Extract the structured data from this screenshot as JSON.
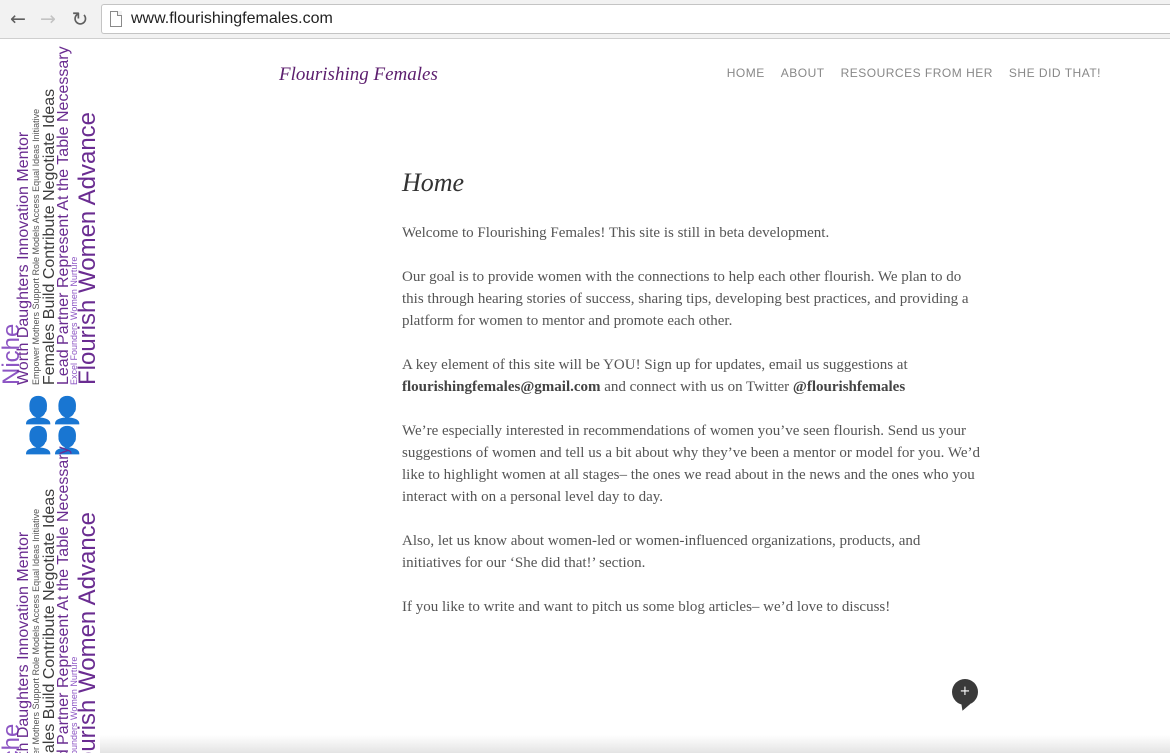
{
  "browser": {
    "back_icon": "←",
    "forward_icon": "→",
    "reload_icon": "↻",
    "url": "www.flourishingfemales.com"
  },
  "sidebar": {
    "cloud_columns": [
      {
        "text": "Niche",
        "cls": "w-big w-pur"
      },
      {
        "text": "Worth Daughters Innovation Mentor",
        "cls": "w-med"
      },
      {
        "text": "Empower Mothers Support Role Models Access Equal Ideas Initiative",
        "cls": "w-sm"
      },
      {
        "text": "Females Build Contribute Negotiate Ideas",
        "cls": "w-med w-dark"
      },
      {
        "text": "Lead Partner Represent At the Table Necessary",
        "cls": "w-med"
      },
      {
        "text": "Excel Founders Women Nurture",
        "cls": "w-sm w-pur"
      },
      {
        "text": "Flourish Women Advance",
        "cls": "w-big"
      }
    ],
    "figures_icon": "👤👤👤👤"
  },
  "site": {
    "title": "Flourishing Females",
    "nav": [
      "HOME",
      "ABOUT",
      "RESOURCES FROM HER",
      "SHE DID THAT!"
    ]
  },
  "content": {
    "heading": "Home",
    "p1": "Welcome to Flourishing Females! This site is still in beta development.",
    "p2": "Our goal is to provide women with the connections to help each other flourish.  We plan to do this through hearing stories of success, sharing tips, developing best practices, and providing a platform for women to mentor and promote each other.",
    "p3_before": "A key element of this site will be YOU! Sign up for updates, email us suggestions at ",
    "p3_email": "flourishingfemales@gmail.com",
    "p3_middle": " and connect with us on Twitter ",
    "p3_twitter": "@flourishfemales",
    "p4": "We’re especially interested in recommendations of women you’ve seen flourish. Send us your suggestions of women and tell us a bit about why they’ve been a mentor or model for you. We’d like to highlight women at all stages– the ones we read about in the news and the ones who you interact with on a personal level day to day.",
    "p5": "Also, let us know about women-led or women-influenced organizations, products, and initiatives for our ‘She did that!’ section.",
    "p6": "If you like to write and want to pitch us some blog articles– we’d love to discuss!"
  },
  "widget": {
    "bubble_label": "+"
  }
}
